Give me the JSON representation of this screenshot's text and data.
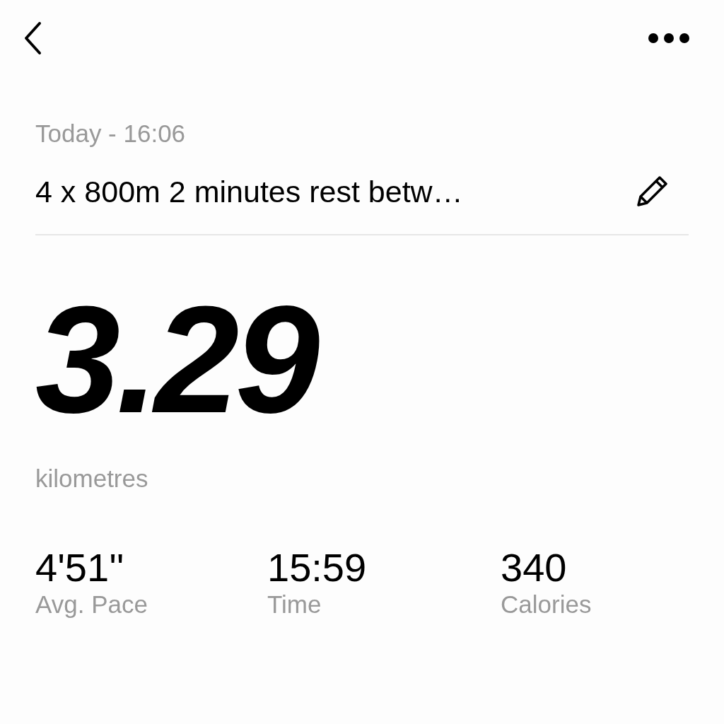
{
  "header": {
    "date": "Today - 16:06",
    "title": "4 x 800m 2 minutes rest betw…"
  },
  "distance": {
    "value": "3.29",
    "unit": "kilometres"
  },
  "stats": [
    {
      "value": "4'51''",
      "label": "Avg. Pace"
    },
    {
      "value": "15:59",
      "label": "Time"
    },
    {
      "value": "340",
      "label": "Calories"
    }
  ]
}
